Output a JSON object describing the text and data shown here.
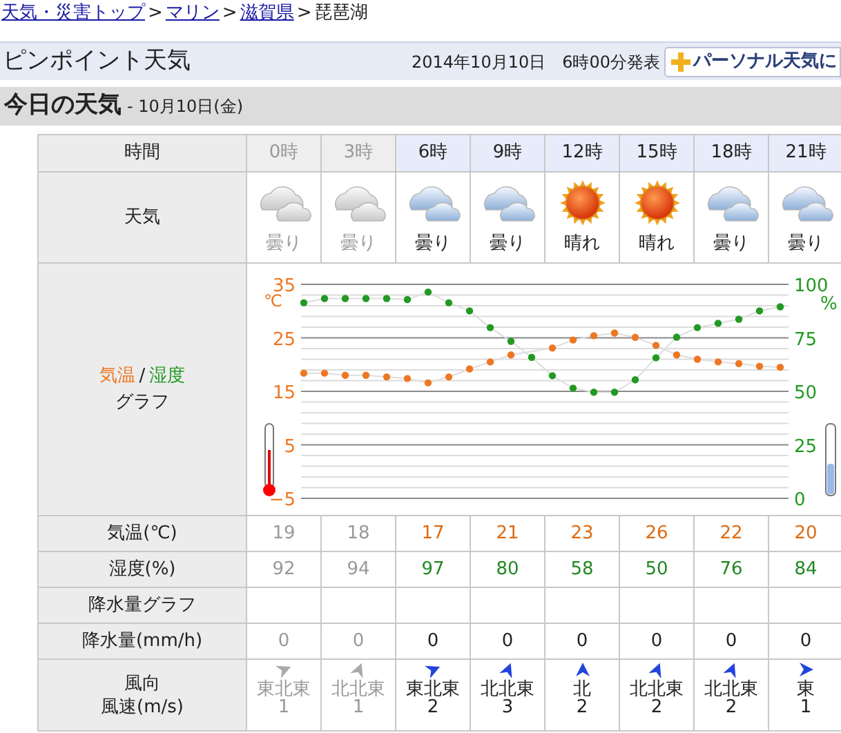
{
  "breadcrumb": [
    {
      "label": "天気・災害トップ",
      "link": true,
      "separator": ">"
    },
    {
      "label": "マリン",
      "link": true,
      "separator": ">"
    },
    {
      "label": "滋賀県",
      "link": true,
      "separator": ">"
    },
    {
      "label": "琵琶湖",
      "link": false
    }
  ],
  "header": {
    "title": "ピンポイント天気",
    "published": "2014年10月10日　6時00分発表",
    "personal_button": "パーソナル天気に"
  },
  "today": {
    "title": "今日の天気",
    "date": "- 10月10日(金)"
  },
  "row_labels": {
    "time": "時間",
    "weather": "天気",
    "graph": {
      "separator": "/",
      "suffix": "グラフ"
    },
    "temp": "気温(℃)",
    "humidity": "湿度(%)",
    "rain_graph": "降水量グラフ",
    "rain": "降水量(mm/h)",
    "wind": [
      "風向",
      "風速(m/s)"
    ]
  },
  "columns": [
    {
      "hour": "0時",
      "past": true,
      "weather": {
        "kind": "cloudy",
        "label": "曇り"
      },
      "temp": "19",
      "humidity": "92",
      "rain": "0",
      "wind": {
        "kind": "ene",
        "direction": "東北東",
        "speed": "1"
      }
    },
    {
      "hour": "3時",
      "past": true,
      "weather": {
        "kind": "cloudy",
        "label": "曇り"
      },
      "temp": "18",
      "humidity": "94",
      "rain": "0",
      "wind": {
        "kind": "nne",
        "direction": "北北東",
        "speed": "1"
      }
    },
    {
      "hour": "6時",
      "past": false,
      "weather": {
        "kind": "cloudy",
        "label": "曇り"
      },
      "temp": "17",
      "humidity": "97",
      "rain": "0",
      "wind": {
        "kind": "ene",
        "direction": "東北東",
        "speed": "2"
      }
    },
    {
      "hour": "9時",
      "past": false,
      "weather": {
        "kind": "cloudy",
        "label": "曇り"
      },
      "temp": "21",
      "humidity": "80",
      "rain": "0",
      "wind": {
        "kind": "nne",
        "direction": "北北東",
        "speed": "3"
      }
    },
    {
      "hour": "12時",
      "past": false,
      "weather": {
        "kind": "sunny",
        "label": "晴れ"
      },
      "temp": "23",
      "humidity": "58",
      "rain": "0",
      "wind": {
        "kind": "n",
        "direction": "北",
        "speed": "2"
      }
    },
    {
      "hour": "15時",
      "past": false,
      "weather": {
        "kind": "sunny",
        "label": "晴れ"
      },
      "temp": "26",
      "humidity": "50",
      "rain": "0",
      "wind": {
        "kind": "nne",
        "direction": "北北東",
        "speed": "2"
      }
    },
    {
      "hour": "18時",
      "past": false,
      "weather": {
        "kind": "cloudy",
        "label": "曇り"
      },
      "temp": "22",
      "humidity": "76",
      "rain": "0",
      "wind": {
        "kind": "nne",
        "direction": "北北東",
        "speed": "2"
      }
    },
    {
      "hour": "21時",
      "past": false,
      "weather": {
        "kind": "cloudy",
        "label": "曇り"
      },
      "temp": "20",
      "humidity": "84",
      "rain": "0",
      "wind": {
        "kind": "e",
        "direction": "東",
        "speed": "1"
      }
    }
  ],
  "chart_data": {
    "type": "line",
    "grid": true,
    "ylim": [
      -5,
      35
    ],
    "yticks": [
      -5,
      5,
      15,
      25,
      35
    ],
    "ylabel": "℃",
    "y2lim": [
      0,
      100
    ],
    "y2ticks": [
      0,
      25,
      50,
      75,
      100
    ],
    "y2label": "%",
    "series": [
      {
        "name": "気温",
        "color": "#ee7722",
        "marker": "circle",
        "values": [
          18.4,
          18.4,
          18.0,
          18.0,
          17.7,
          17.4,
          16.6,
          17.7,
          19.2,
          20.5,
          21.8,
          null,
          23.1,
          24.6,
          25.4,
          25.9,
          25.1,
          23.6,
          21.8,
          21.0,
          20.5,
          20.2,
          19.7,
          19.5
        ]
      },
      {
        "name": "湿度",
        "color": "#229922",
        "axis": "y2",
        "marker": "circle",
        "values": [
          91.4,
          93.4,
          93.4,
          93.4,
          93.4,
          92.9,
          96.4,
          91.4,
          87.6,
          79.8,
          73.4,
          65.9,
          57.3,
          51.5,
          49.6,
          49.6,
          55.4,
          65.7,
          75.3,
          79.8,
          81.8,
          83.7,
          87.6,
          89.5
        ]
      }
    ]
  }
}
